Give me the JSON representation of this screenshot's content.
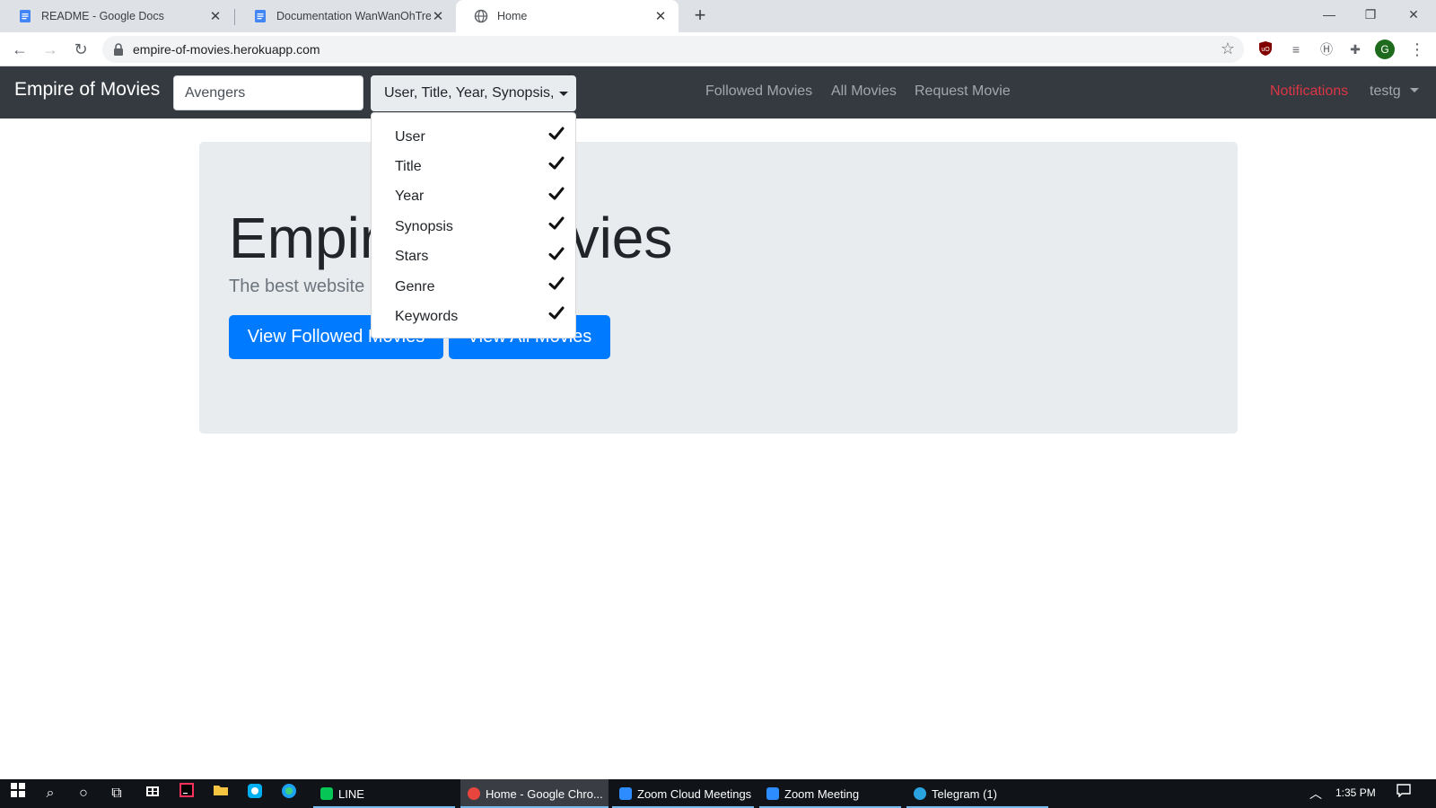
{
  "browser": {
    "tabs": [
      {
        "title": "README - Google Docs",
        "icon": "google-docs-icon"
      },
      {
        "title": "Documentation WanWanOhTree",
        "icon": "google-docs-icon"
      },
      {
        "title": "Home",
        "icon": "globe-icon"
      }
    ],
    "url": "empire-of-movies.herokuapp.com",
    "profile_initial": "G"
  },
  "navbar": {
    "brand": "Empire of Movies",
    "search_value": "Avengers",
    "filter_label": "User, Title, Year, Synopsis,",
    "links": {
      "followed": "Followed Movies",
      "all": "All Movies",
      "request": "Request Movie"
    },
    "notifications": "Notifications",
    "username": "testg"
  },
  "dropdown": {
    "items": [
      {
        "label": "User",
        "checked": true
      },
      {
        "label": "Title",
        "checked": true
      },
      {
        "label": "Year",
        "checked": true
      },
      {
        "label": "Synopsis",
        "checked": true
      },
      {
        "label": "Stars",
        "checked": true
      },
      {
        "label": "Genre",
        "checked": true
      },
      {
        "label": "Keywords",
        "checked": true
      }
    ]
  },
  "jumbotron": {
    "title": "Empire of Movies",
    "lead": "The best website",
    "buttons": {
      "followed": "View Followed Movies",
      "all": "View All Movies"
    }
  },
  "taskbar": {
    "apps": [
      {
        "label": "LINE",
        "icon": "line-icon"
      },
      {
        "label": "Home - Google Chro...",
        "icon": "chrome-icon"
      },
      {
        "label": "Zoom Cloud Meetings",
        "icon": "zoom-icon"
      },
      {
        "label": "Zoom Meeting",
        "icon": "zoom-icon"
      },
      {
        "label": "Telegram (1)",
        "icon": "telegram-icon"
      }
    ],
    "time": "1:35 PM"
  },
  "colors": {
    "navbar_bg": "#343a40",
    "primary": "#007bff",
    "danger": "#dc3545",
    "jumbotron_bg": "#e9ecef"
  }
}
